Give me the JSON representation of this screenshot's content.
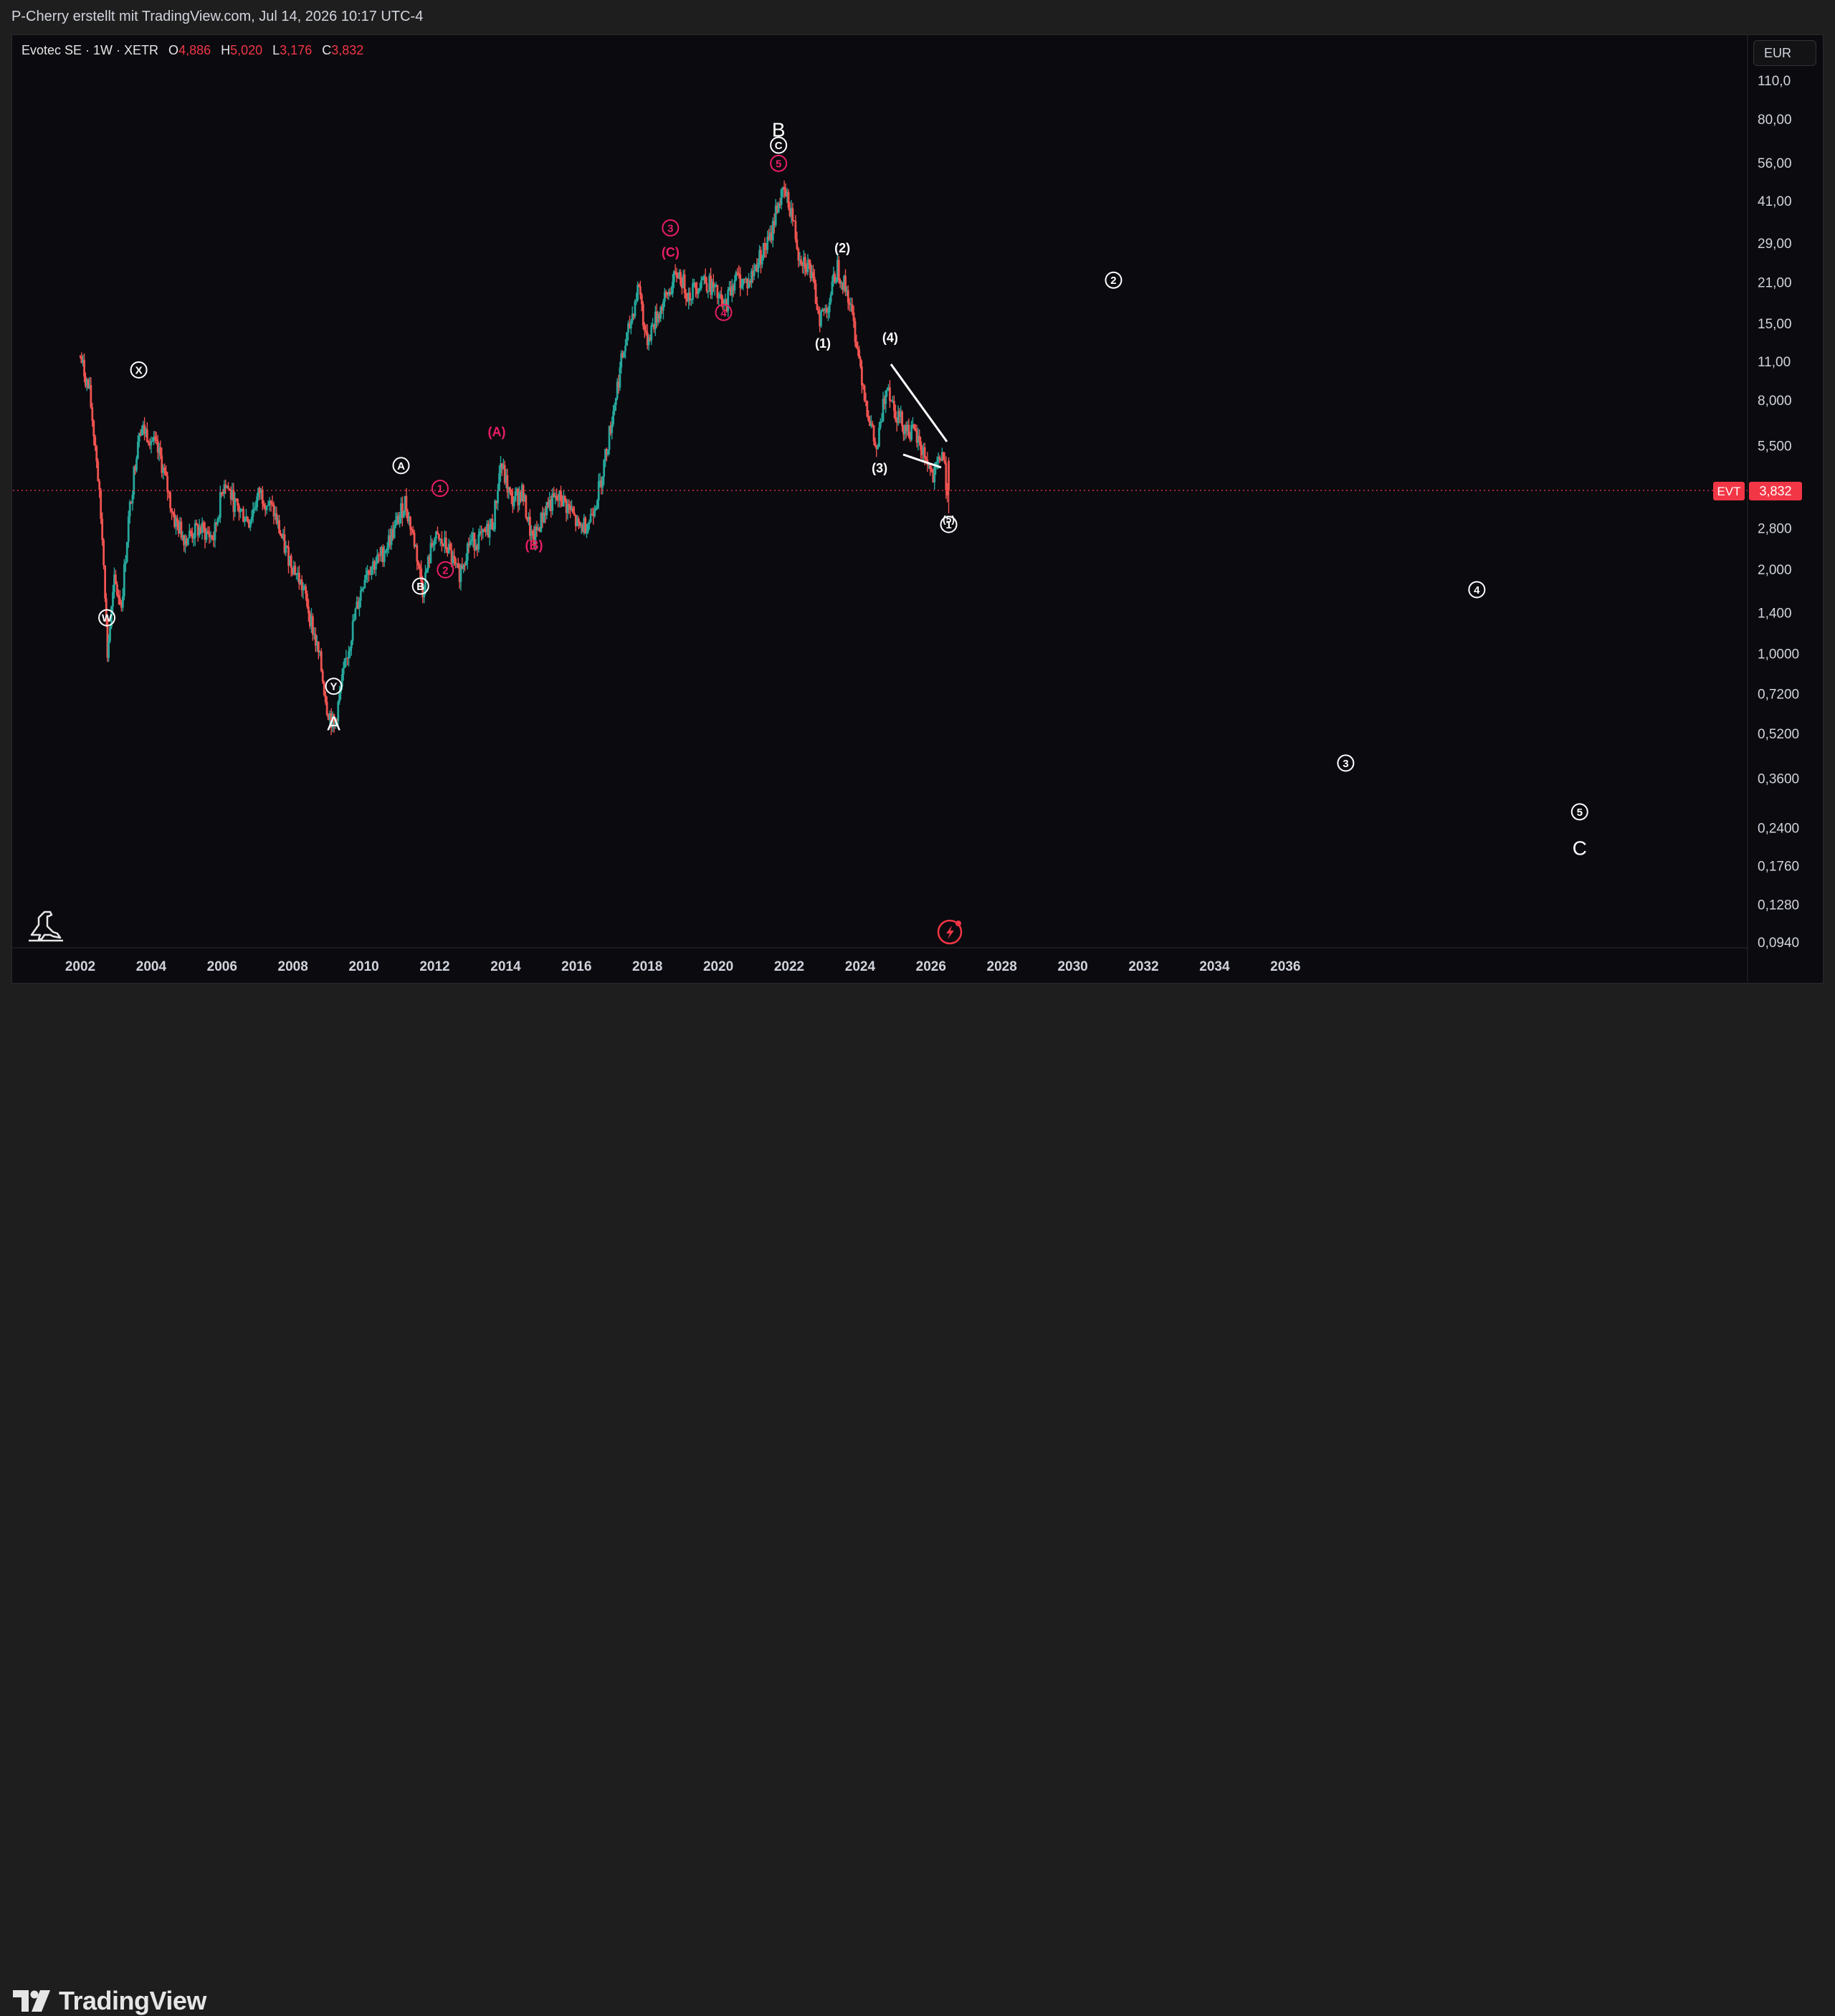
{
  "header": {
    "attribution": "P-Cherry erstellt mit TradingView.com, Jul 14, 2026 10:17 UTC-4"
  },
  "legend": {
    "symbol": "Evotec SE · 1W · XETR",
    "open_label": "O",
    "open": "4,886",
    "high_label": "H",
    "high": "5,020",
    "low_label": "L",
    "low": "3,176",
    "close_label": "C",
    "close": "3,832"
  },
  "currency_button": "EUR",
  "price_tag": {
    "ticker": "EVT",
    "value": "3,832"
  },
  "footer": {
    "brand": "TradingView"
  },
  "colors": {
    "up": "#26a69a",
    "down": "#ef5350",
    "accent": "#e91e63",
    "price_tag": "#f23645",
    "background": "#0a0a0f"
  },
  "chart_data": {
    "type": "candlestick",
    "title": "Evotec SE · 1W · XETR",
    "y_scale": "log",
    "y_ticks": [
      "110,0",
      "80,00",
      "56,00",
      "41,00",
      "29,00",
      "21,00",
      "15,00",
      "11,00",
      "8,000",
      "5,500",
      "2,800",
      "2,000",
      "1,400",
      "1,0000",
      "0,7200",
      "0,5200",
      "0,3600",
      "0,2400",
      "0,1760",
      "0,1280",
      "0,0940"
    ],
    "y_tick_values": [
      110,
      80,
      56,
      41,
      29,
      21,
      15,
      11,
      8,
      5.5,
      2.8,
      2.0,
      1.4,
      1.0,
      0.72,
      0.52,
      0.36,
      0.24,
      0.176,
      0.128,
      0.094
    ],
    "x_ticks": [
      "2002",
      "2004",
      "2006",
      "2008",
      "2010",
      "2012",
      "2014",
      "2016",
      "2018",
      "2020",
      "2022",
      "2024",
      "2026",
      "2028",
      "2030",
      "2032",
      "2034",
      "2036"
    ],
    "x_tick_values": [
      2002,
      2004,
      2006,
      2008,
      2010,
      2012,
      2014,
      2016,
      2018,
      2020,
      2022,
      2024,
      2026,
      2028,
      2030,
      2032,
      2034,
      2036
    ],
    "last_price": 3.832,
    "price_path": [
      [
        2002.0,
        12.0
      ],
      [
        2002.3,
        8.5
      ],
      [
        2002.5,
        5.0
      ],
      [
        2002.7,
        2.2
      ],
      [
        2002.8,
        1.0
      ],
      [
        2003.0,
        1.8
      ],
      [
        2003.2,
        1.5
      ],
      [
        2003.4,
        3.0
      ],
      [
        2003.7,
        6.5
      ],
      [
        2004.0,
        6.0
      ],
      [
        2004.3,
        5.0
      ],
      [
        2004.7,
        3.0
      ],
      [
        2005.0,
        2.6
      ],
      [
        2005.4,
        2.8
      ],
      [
        2005.8,
        2.6
      ],
      [
        2006.1,
        4.2
      ],
      [
        2006.4,
        3.4
      ],
      [
        2006.8,
        3.0
      ],
      [
        2007.1,
        3.8
      ],
      [
        2007.5,
        3.2
      ],
      [
        2007.8,
        2.4
      ],
      [
        2008.1,
        2.0
      ],
      [
        2008.4,
        1.6
      ],
      [
        2008.8,
        0.95
      ],
      [
        2009.0,
        0.65
      ],
      [
        2009.2,
        0.55
      ],
      [
        2009.5,
        0.9
      ],
      [
        2009.8,
        1.4
      ],
      [
        2010.1,
        2.0
      ],
      [
        2010.5,
        2.2
      ],
      [
        2010.9,
        2.8
      ],
      [
        2011.2,
        3.5
      ],
      [
        2011.5,
        2.4
      ],
      [
        2011.7,
        1.7
      ],
      [
        2012.0,
        2.6
      ],
      [
        2012.4,
        2.4
      ],
      [
        2012.7,
        1.9
      ],
      [
        2013.0,
        2.5
      ],
      [
        2013.4,
        2.6
      ],
      [
        2013.7,
        3.0
      ],
      [
        2013.9,
        4.8
      ],
      [
        2014.2,
        3.5
      ],
      [
        2014.5,
        3.8
      ],
      [
        2014.8,
        2.5
      ],
      [
        2015.2,
        3.4
      ],
      [
        2015.6,
        3.6
      ],
      [
        2015.9,
        3.2
      ],
      [
        2016.1,
        2.8
      ],
      [
        2016.4,
        3.0
      ],
      [
        2016.7,
        4.0
      ],
      [
        2017.0,
        6.5
      ],
      [
        2017.3,
        11.0
      ],
      [
        2017.5,
        14.0
      ],
      [
        2017.8,
        21.0
      ],
      [
        2018.0,
        13.0
      ],
      [
        2018.3,
        16.0
      ],
      [
        2018.6,
        19.0
      ],
      [
        2018.9,
        23.0
      ],
      [
        2019.2,
        19.0
      ],
      [
        2019.6,
        22.0
      ],
      [
        2019.9,
        20.0
      ],
      [
        2020.2,
        17.0
      ],
      [
        2020.5,
        22.0
      ],
      [
        2020.9,
        21.0
      ],
      [
        2021.2,
        26.0
      ],
      [
        2021.5,
        30.0
      ],
      [
        2021.7,
        40.0
      ],
      [
        2021.9,
        44.0
      ],
      [
        2022.1,
        38.0
      ],
      [
        2022.3,
        27.0
      ],
      [
        2022.6,
        24.0
      ],
      [
        2022.9,
        16.0
      ],
      [
        2023.1,
        17.0
      ],
      [
        2023.4,
        24.0
      ],
      [
        2023.7,
        19.0
      ],
      [
        2023.9,
        14.0
      ],
      [
        2024.2,
        8.0
      ],
      [
        2024.5,
        5.2
      ],
      [
        2024.8,
        9.5
      ],
      [
        2025.0,
        7.5
      ],
      [
        2025.3,
        6.5
      ],
      [
        2025.6,
        6.0
      ],
      [
        2025.9,
        5.0
      ],
      [
        2026.1,
        4.2
      ],
      [
        2026.35,
        5.3
      ],
      [
        2026.5,
        3.832
      ]
    ],
    "wave_labels": [
      {
        "text": "B",
        "x": 2021.7,
        "y": 74,
        "style": "big"
      },
      {
        "text": "C",
        "x": 2021.7,
        "y": 65,
        "style": "circle"
      },
      {
        "text": "5",
        "x": 2021.7,
        "y": 56,
        "style": "circle-pink"
      },
      {
        "text": "3",
        "x": 2018.65,
        "y": 33,
        "style": "circle-pink"
      },
      {
        "text": "(C)",
        "x": 2018.65,
        "y": 27,
        "style": "paren-pink"
      },
      {
        "text": "4",
        "x": 2020.15,
        "y": 16.5,
        "style": "circle-pink"
      },
      {
        "text": "(2)",
        "x": 2023.5,
        "y": 28,
        "style": "paren"
      },
      {
        "text": "(1)",
        "x": 2022.95,
        "y": 12.8,
        "style": "paren"
      },
      {
        "text": "(4)",
        "x": 2024.85,
        "y": 13.4,
        "style": "paren"
      },
      {
        "text": "(3)",
        "x": 2024.55,
        "y": 4.6,
        "style": "paren"
      },
      {
        "text": "(5)",
        "x": 2026.5,
        "y": 3.05,
        "style": "paren-small"
      },
      {
        "text": "1",
        "x": 2026.5,
        "y": 2.9,
        "style": "circle"
      },
      {
        "text": "X",
        "x": 2003.65,
        "y": 10.3,
        "style": "circle"
      },
      {
        "text": "W",
        "x": 2002.75,
        "y": 1.35,
        "style": "circle"
      },
      {
        "text": "Y",
        "x": 2009.15,
        "y": 0.77,
        "style": "circle"
      },
      {
        "text": "A",
        "x": 2009.15,
        "y": 0.57,
        "style": "big"
      },
      {
        "text": "A",
        "x": 2011.05,
        "y": 4.7,
        "style": "circle"
      },
      {
        "text": "B",
        "x": 2011.6,
        "y": 1.75,
        "style": "circle"
      },
      {
        "text": "1",
        "x": 2012.15,
        "y": 3.9,
        "style": "circle-pink"
      },
      {
        "text": "2",
        "x": 2012.3,
        "y": 2.0,
        "style": "circle-pink"
      },
      {
        "text": "(A)",
        "x": 2013.75,
        "y": 6.2,
        "style": "paren-pink"
      },
      {
        "text": "(B)",
        "x": 2014.8,
        "y": 2.45,
        "style": "paren-pink"
      },
      {
        "text": "2",
        "x": 2031.15,
        "y": 21.5,
        "style": "circle"
      },
      {
        "text": "4",
        "x": 2041.4,
        "y": 1.7,
        "style": "circle"
      },
      {
        "text": "3",
        "x": 2037.7,
        "y": 0.41,
        "style": "circle"
      },
      {
        "text": "5",
        "x": 2044.3,
        "y": 0.275,
        "style": "circle"
      },
      {
        "text": "C",
        "x": 2044.3,
        "y": 0.205,
        "style": "big"
      }
    ]
  }
}
